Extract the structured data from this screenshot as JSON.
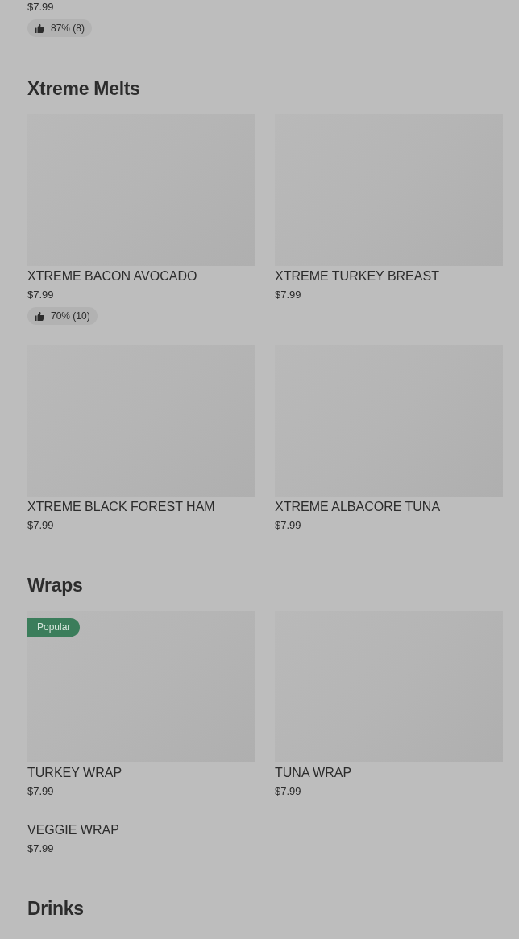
{
  "top_item": {
    "price": "$7.99",
    "rating": "87% (8)"
  },
  "sections": [
    {
      "title": "Xtreme Melts",
      "items": [
        {
          "name": "XTREME BACON AVOCADO",
          "price": "$7.99",
          "rating": "70% (10)",
          "has_image": true
        },
        {
          "name": "XTREME TURKEY BREAST",
          "price": "$7.99",
          "has_image": true
        },
        {
          "name": "XTREME BLACK FOREST HAM",
          "price": "$7.99",
          "has_image": true
        },
        {
          "name": "XTREME ALBACORE TUNA",
          "price": "$7.99",
          "has_image": true
        }
      ]
    },
    {
      "title": "Wraps",
      "items": [
        {
          "name": "TURKEY WRAP",
          "price": "$7.99",
          "badge": "Popular",
          "has_image": true
        },
        {
          "name": "TUNA WRAP",
          "price": "$7.99",
          "has_image": true
        },
        {
          "name": "VEGGIE WRAP",
          "price": "$7.99",
          "has_image": false
        }
      ]
    },
    {
      "title": "Drinks"
    }
  ]
}
